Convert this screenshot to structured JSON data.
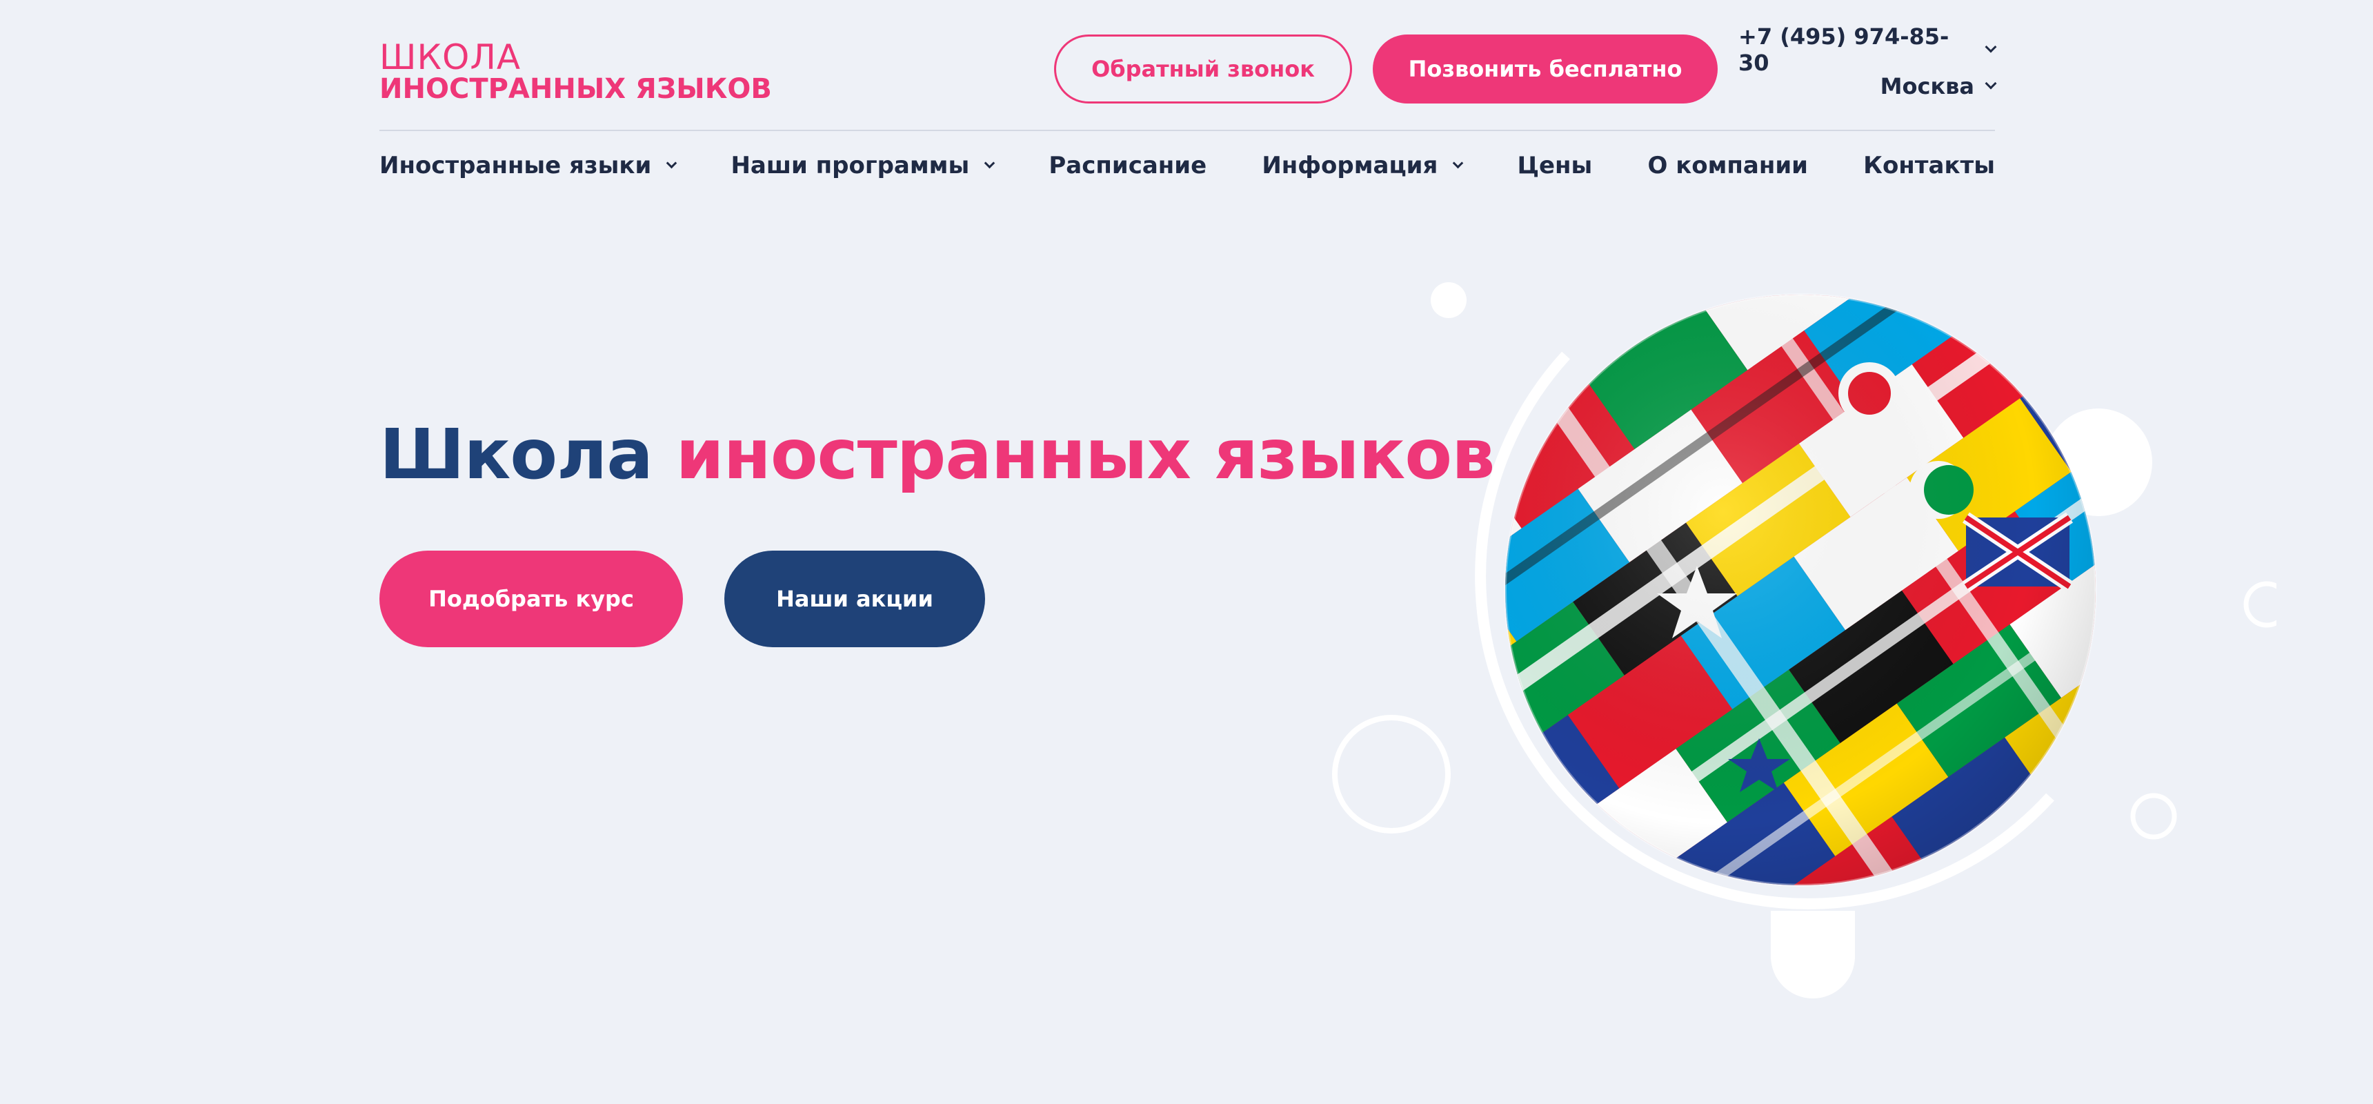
{
  "header": {
    "logo_line1": "ШКОЛА",
    "logo_line2": "ИНОСТРАННЫХ ЯЗЫКОВ",
    "callback_button": "Обратный звонок",
    "call_free_button": "Позвонить бесплатно",
    "phone": "+7 (495) 974-85-30",
    "city": "Москва"
  },
  "nav": {
    "items": [
      {
        "label": "Иностранные языки"
      },
      {
        "label": "Наши программы"
      },
      {
        "label": "Расписание"
      },
      {
        "label": "Информация"
      },
      {
        "label": "Цены"
      },
      {
        "label": "О компании"
      },
      {
        "label": "Контакты"
      }
    ]
  },
  "hero": {
    "title_part1": "Школа",
    "title_part2": "иностранных языков",
    "primary_button": "Подобрать курс",
    "secondary_button": "Наши акции",
    "image": "flags-globe-illustration"
  },
  "colors": {
    "accent": "#ee3778",
    "brand": "#1f4278",
    "background": "#eef1f7",
    "text": "#1f2a44"
  }
}
